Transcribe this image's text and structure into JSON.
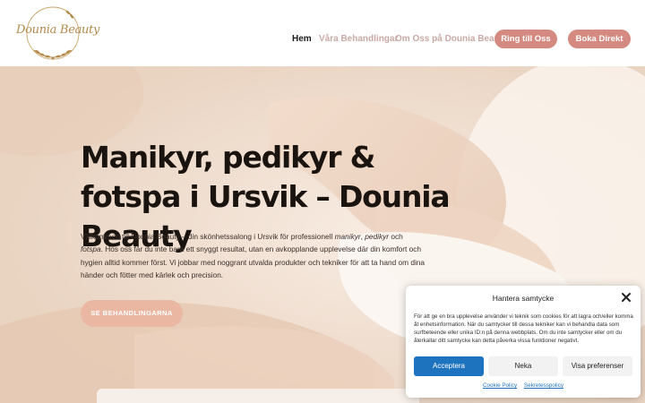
{
  "brand": {
    "logo_text": "Dounia Beauty",
    "accent": "#d48a80",
    "gold": "#b48a4c"
  },
  "nav": {
    "items": [
      {
        "label": "Hem"
      },
      {
        "label": "Våra Behandlingar"
      },
      {
        "label": "Om Oss på Dounia Beauty"
      }
    ],
    "call_button": "Ring till Oss",
    "book_button": "Boka Direkt"
  },
  "hero": {
    "title": "Manikyr, pedikyr & fotspa i Ursvik – Dounia Beauty",
    "text_part1": "Välkommen till Dounia Beauty – din skönhetssalong i Ursvik för professionell ",
    "text_em1": "manikyr",
    "text_sep1": ", ",
    "text_em2": "pedikyr",
    "text_sep2": " och ",
    "text_em3": "fotspa",
    "text_part2": ". Hos oss får du inte bara ett snyggt resultat, utan en avkopplande upplevelse där din komfort och hygien alltid kommer först. Vi jobbar med noggrant utvalda produkter och tekniker för att ta hand om dina händer och fötter med kärlek och precision.",
    "cta": "SE BEHANDLINGARNA"
  },
  "cookie": {
    "title": "Hantera samtycke",
    "body": "För att ge en bra upplevelse använder vi teknik som cookies för att lagra och/eller komma åt enhetsinformation. När du samtycker till dessa tekniker kan vi behandla data som surfbeteende eller unika ID:n på denna webbplats. Om du inte samtycker eller om du återkallar ditt samtycke kan detta påverka vissa funktioner negativt.",
    "accept": "Acceptera",
    "deny": "Neka",
    "preferences": "Visa preferenser",
    "links": [
      "Cookie Policy",
      "Sekretesspolicy"
    ],
    "accept_color": "#1e73be"
  }
}
